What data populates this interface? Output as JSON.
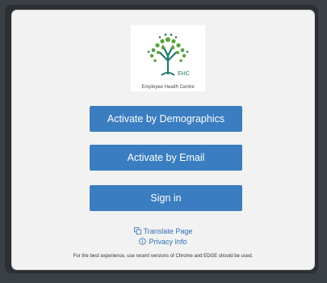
{
  "logo": {
    "initials": "EHC",
    "caption": "Employee Health Centre"
  },
  "buttons": {
    "demographics": "Activate by Demographics",
    "email": "Activate by Email",
    "signin": "Sign in"
  },
  "links": {
    "translate": "Translate Page",
    "privacy": "Privacy Info"
  },
  "notice": "For the best experience, use recent versions of Chrome and EDGE should be used.",
  "colors": {
    "button": "#3a7dc0",
    "link": "#2f6fb3",
    "tree_green": "#5aa23c",
    "tree_trunk": "#1f7a6b"
  }
}
